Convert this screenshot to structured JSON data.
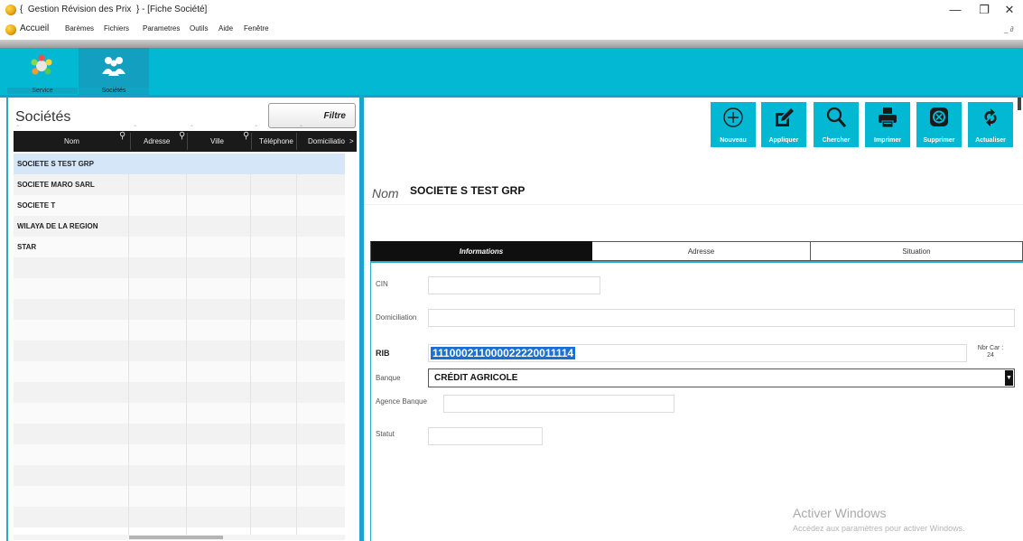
{
  "window": {
    "title": "{  Gestion Révision des Prix  } - [Fiche Société]",
    "minimize": "—",
    "maximize": "❐",
    "close": "✕"
  },
  "menu": {
    "items": [
      "Accueil",
      "Barèmes",
      "Fichiers",
      "Parametres",
      "Outils",
      "Aide",
      "Fenêtre"
    ],
    "mdi_controls": "_ ∂"
  },
  "modules": [
    {
      "label": "Service",
      "icon": "service-icon"
    },
    {
      "label": "Sociétés",
      "icon": "societes-icon",
      "selected": true
    }
  ],
  "left_panel": {
    "title": "Sociétés",
    "filter_button": "Filtre",
    "columns": [
      "Nom",
      "Adresse",
      "Ville",
      "Téléphone",
      "Domiciliatio",
      ">"
    ],
    "rows": [
      {
        "nom": "SOCIETE S TEST GRP",
        "selected": true
      },
      {
        "nom": "SOCIETE MARO SARL"
      },
      {
        "nom": "SOCIETE T"
      },
      {
        "nom": "WILAYA DE LA REGION"
      },
      {
        "nom": "STAR"
      }
    ]
  },
  "toolbar": {
    "buttons": [
      {
        "label": "Nouveau",
        "icon": "plus-circle-icon"
      },
      {
        "label": "Appliquer",
        "icon": "edit-icon"
      },
      {
        "label": "Chercher",
        "icon": "search-icon"
      },
      {
        "label": "Imprimer",
        "icon": "printer-icon"
      },
      {
        "label": "Supprimer",
        "icon": "delete-icon"
      },
      {
        "label": "Actualiser",
        "icon": "refresh-icon"
      }
    ]
  },
  "record": {
    "nom_label": "Nom",
    "nom_value": "SOCIETE S TEST GRP"
  },
  "tabs": [
    {
      "label": "Informations",
      "active": true
    },
    {
      "label": "Adresse"
    },
    {
      "label": "Situation"
    }
  ],
  "form": {
    "cin_label": "CIN",
    "cin_value": "",
    "domiciliation_label": "Domiciliation",
    "domiciliation_value": "",
    "rib_label": "RIB",
    "rib_value": "111000211000022220011114",
    "nbr_car_label": "Nbr Car  :",
    "nbr_car_value": "24",
    "banque_label": "Banque",
    "banque_value": "CRÉDIT AGRICOLE",
    "agence_label": "Agence Banque",
    "agence_value": "",
    "statut_label": "Statut",
    "statut_value": ""
  },
  "watermark": {
    "line1": "Activer Windows",
    "line2": "Accédez aux paramètres pour activer Windows."
  },
  "colors": {
    "accent": "#03b8d2",
    "header_dark": "#1a1a1a",
    "selection": "#d4e6f7"
  }
}
